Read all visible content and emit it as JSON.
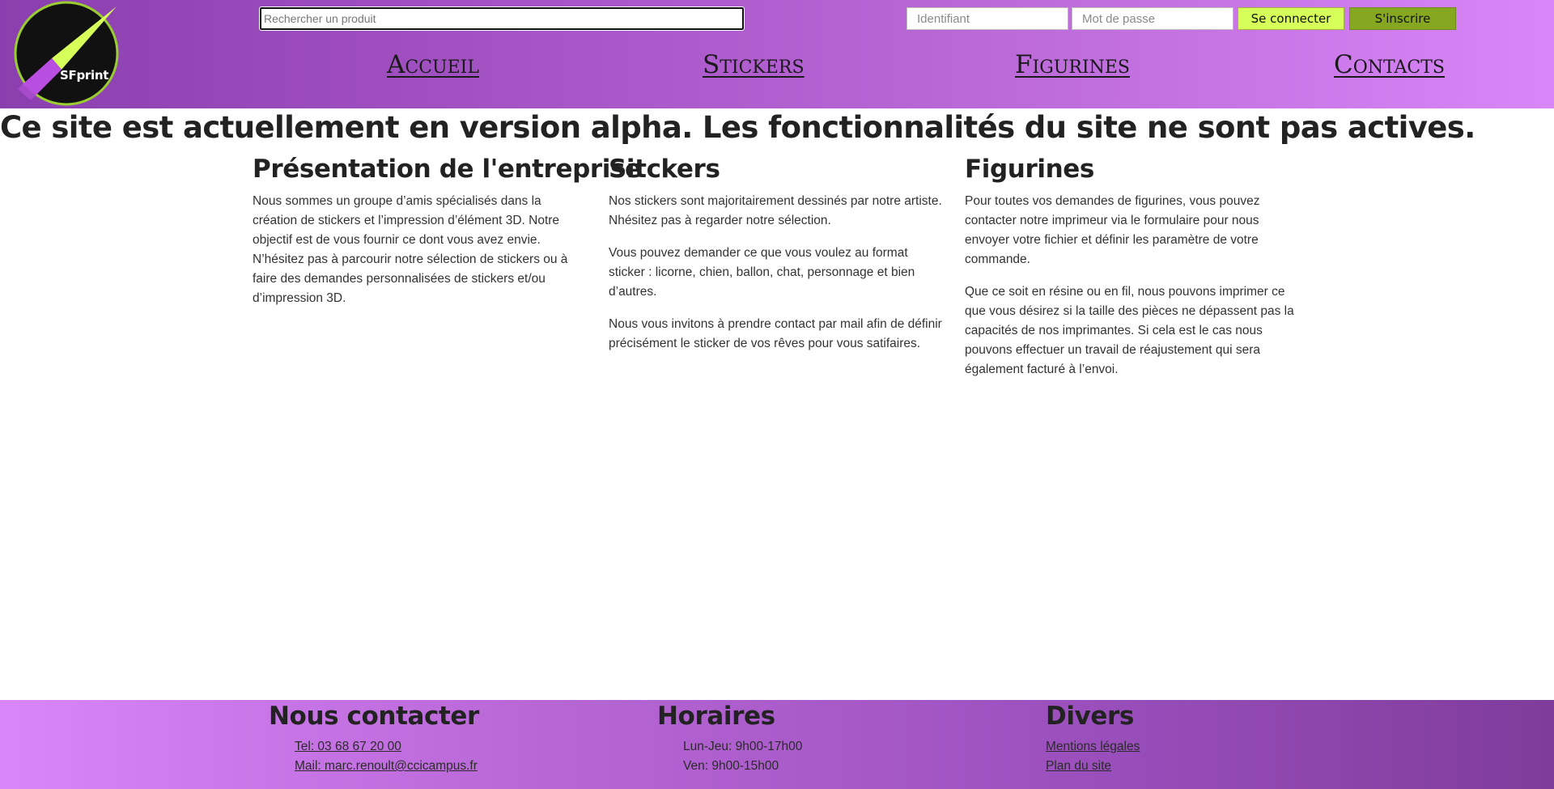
{
  "header": {
    "logo": {
      "text": "SFprint",
      "colors": {
        "circle": "#111111",
        "ring": "#9acd32",
        "blade_green": "#d6ff5a",
        "blade_purple": "#b84fe0"
      }
    },
    "search": {
      "placeholder": "Rechercher un produit",
      "value": ""
    },
    "login": {
      "username_placeholder": "Identifiant",
      "password_placeholder": "Mot de passe",
      "login_button": "Se connecter",
      "signup_button": "S'inscrire"
    },
    "nav": [
      {
        "label": "Accueil"
      },
      {
        "label": "Stickers"
      },
      {
        "label": "Figurines"
      },
      {
        "label": "Contacts"
      }
    ]
  },
  "main": {
    "alpha_notice": "Ce site est actuellement en version alpha. Les fonctionnalités du site ne sont pas actives.",
    "columns": [
      {
        "title": "Présentation de l'entreprise",
        "paragraphs": [
          "Nous sommes un groupe d’amis spécialisés dans la création de stickers et l’impression d’élément 3D. Notre objectif est de vous fournir ce dont vous avez envie. N’hésitez pas à parcourir notre sélection de stickers ou à faire des demandes personnalisées de stickers et/ou d’impression 3D."
        ]
      },
      {
        "title": "Sitckers",
        "paragraphs": [
          "Nos stickers sont majoritairement dessinés par notre artiste. Nhésitez pas à regarder notre sélection.",
          "Vous pouvez demander ce que vous voulez au format sticker : licorne, chien, ballon, chat, personnage et bien d’autres.",
          "Nous vous invitons à prendre contact par mail afin de définir précisément le sticker de vos rêves pour vous satifaires."
        ]
      },
      {
        "title": "Figurines",
        "paragraphs": [
          "Pour toutes vos demandes de figurines, vous pouvez contacter notre imprimeur via le formulaire pour nous envoyer votre fichier et définir les paramètre de votre commande.",
          "Que ce soit en résine ou en fil, nous pouvons imprimer ce que vous désirez si la taille des pièces ne dépassent pas la capacités de nos imprimantes. Si cela est le cas nous pouvons effectuer un travail de réajustement qui sera également facturé à l’envoi."
        ]
      }
    ]
  },
  "footer": {
    "contact": {
      "title": "Nous contacter",
      "phone": "Tel: 03 68 67 20 00",
      "mail": "Mail: marc.renoult@ccicampus.fr"
    },
    "hours": {
      "title": "Horaires",
      "lines": [
        "Lun-Jeu: 9h00-17h00",
        "Ven: 9h00-15h00"
      ]
    },
    "misc": {
      "title": "Divers",
      "links": [
        "Mentions légales",
        "Plan du site"
      ]
    }
  }
}
